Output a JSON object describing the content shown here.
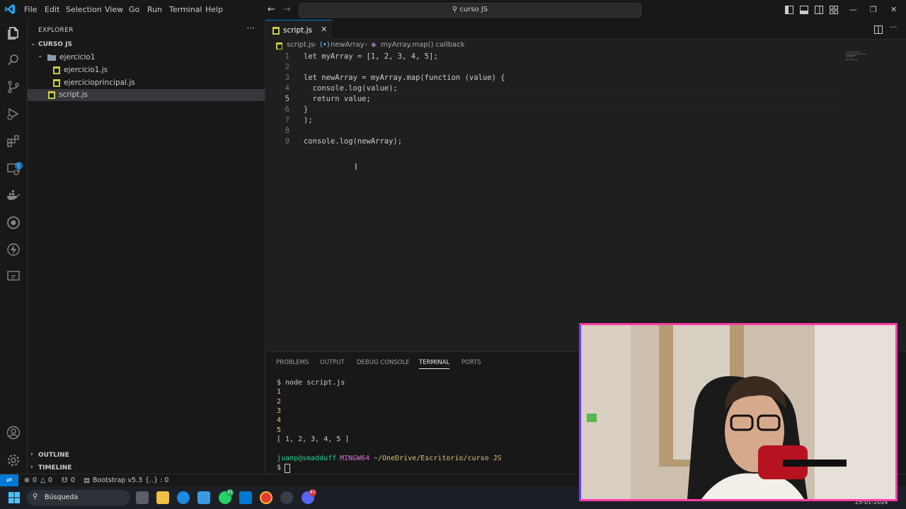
{
  "window": {
    "search_text": "curso JS",
    "menu": [
      "File",
      "Edit",
      "Selection",
      "View",
      "Go",
      "Run",
      "Terminal",
      "Help"
    ]
  },
  "activity_bar": {
    "icons": [
      "files-icon",
      "search-icon",
      "source-control-icon",
      "run-debug-icon",
      "extensions-icon",
      "remote-explorer-icon",
      "docker-icon",
      "copilot-icon",
      "thunder-client-icon",
      "live-share-icon",
      "account-icon",
      "settings-gear-icon"
    ],
    "extensions_badge": "1"
  },
  "sidebar": {
    "title": "EXPLORER",
    "root": "CURSO JS",
    "folder": "ejercicio1",
    "files": [
      "ejercicio1.js",
      "ejercicioprincipal.js",
      "script.js"
    ],
    "outline": "OUTLINE",
    "timeline": "TIMELINE"
  },
  "editor": {
    "tab": "script.js",
    "breadcrumb": [
      "script.js",
      "newArray",
      "myArray.map() callback"
    ],
    "line_numbers": [
      "1",
      "2",
      "3",
      "4",
      "5",
      "6",
      "7",
      "8",
      "9"
    ],
    "code": [
      "let myArray = [1, 2, 3, 4, 5];",
      "",
      "let newArray = myArray.map(function (value) {",
      "  console.log(value);",
      "  return value;",
      "}",
      ");",
      "",
      "console.log(newArray);"
    ]
  },
  "panel": {
    "tabs": [
      "PROBLEMS",
      "OUTPUT",
      "DEBUG CONSOLE",
      "TERMINAL",
      "PORTS"
    ],
    "active_tab": "TERMINAL",
    "terminal": {
      "command": "$ node script.js",
      "output": [
        "1",
        "2",
        "3",
        "4",
        "5",
        "[ 1, 2, 3, 4, 5 ]"
      ],
      "prompt_user": "juanp@smadduff",
      "prompt_env": "MINGW64",
      "prompt_path": "~/OneDrive/Escritorio/curso JS",
      "prompt": "$"
    }
  },
  "status_bar": {
    "errors": "0",
    "warnings": "0",
    "ports": "0",
    "bootstrap": "Bootstrap v5.3",
    "braces": "{..} : 0"
  },
  "taskbar": {
    "search_placeholder": "Búsqueda",
    "date": "25-01-2024",
    "whatsapp_badge": "31",
    "discord_badge": "9+"
  },
  "colors": {
    "accent": "#0078d4",
    "editor_bg": "#1f1f1f",
    "sidebar_bg": "#181818",
    "webcam_border": "#ff3da8"
  }
}
